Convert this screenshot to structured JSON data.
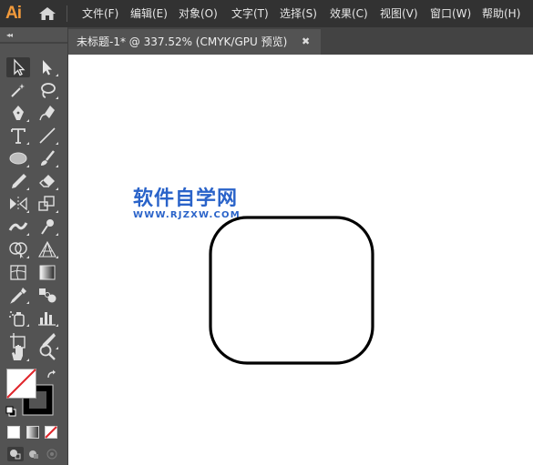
{
  "app": {
    "logo": "Ai"
  },
  "menu": [
    "文件(F)",
    "编辑(E)",
    "对象(O)",
    "文字(T)",
    "选择(S)",
    "效果(C)",
    "视图(V)",
    "窗口(W)",
    "帮助(H)"
  ],
  "document_tab": {
    "title": "未标题-1* @ 337.52% (CMYK/GPU 预览)",
    "close": "✖"
  },
  "tools_panel": {
    "collapse": "◂◂"
  },
  "tools": [
    "selection-tool",
    "direct-selection-tool",
    "magic-wand-tool",
    "lasso-tool",
    "pen-tool",
    "curvature-tool",
    "type-tool",
    "line-segment-tool",
    "ellipse-tool",
    "paintbrush-tool",
    "pencil-tool",
    "eraser-tool",
    "reflect-tool",
    "scale-tool",
    "width-tool",
    "puppet-warp-tool",
    "shape-builder-tool",
    "perspective-grid-tool",
    "mesh-tool",
    "gradient-tool",
    "eyedropper-tool",
    "blend-tool",
    "symbol-sprayer-tool",
    "column-graph-tool",
    "artboard-tool",
    "slice-tool",
    "hand-tool",
    "zoom-tool"
  ],
  "canvas": {
    "watermark_cn": "软件自学网",
    "watermark_url": "WWW.RJZXW.COM"
  },
  "colors": {
    "accent_logo": "#f29a3b",
    "watermark": "#2a63c9",
    "none_swatch_slash": "#e0262b"
  }
}
